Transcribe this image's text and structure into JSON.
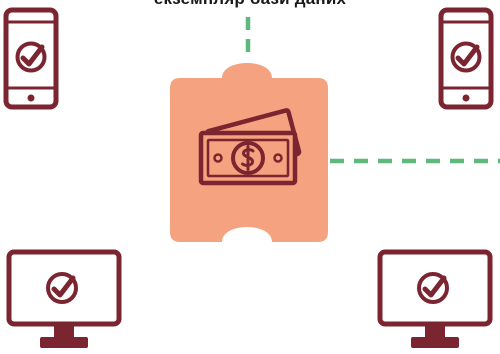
{
  "diagram": {
    "caption": "екземпляр бази даних",
    "colors": {
      "device": "#7b2531",
      "puzzle": "#f4a27f",
      "connector": "#5fb97c",
      "background": "#ffffff",
      "caption": "#1a1a1a"
    },
    "nodes": [
      {
        "name": "phone-top-left",
        "kind": "phone",
        "icon": "check-icon"
      },
      {
        "name": "phone-top-right",
        "kind": "phone",
        "icon": "check-icon"
      },
      {
        "name": "monitor-bottom-left",
        "kind": "monitor",
        "icon": "check-icon"
      },
      {
        "name": "monitor-bottom-right",
        "kind": "monitor",
        "icon": "check-icon"
      },
      {
        "name": "puzzle-piece",
        "kind": "puzzle",
        "icon": "dollar-bill-icon"
      }
    ],
    "connectors": [
      {
        "name": "connector-top",
        "style": "dashed"
      },
      {
        "name": "connector-right",
        "style": "dashed"
      }
    ]
  }
}
